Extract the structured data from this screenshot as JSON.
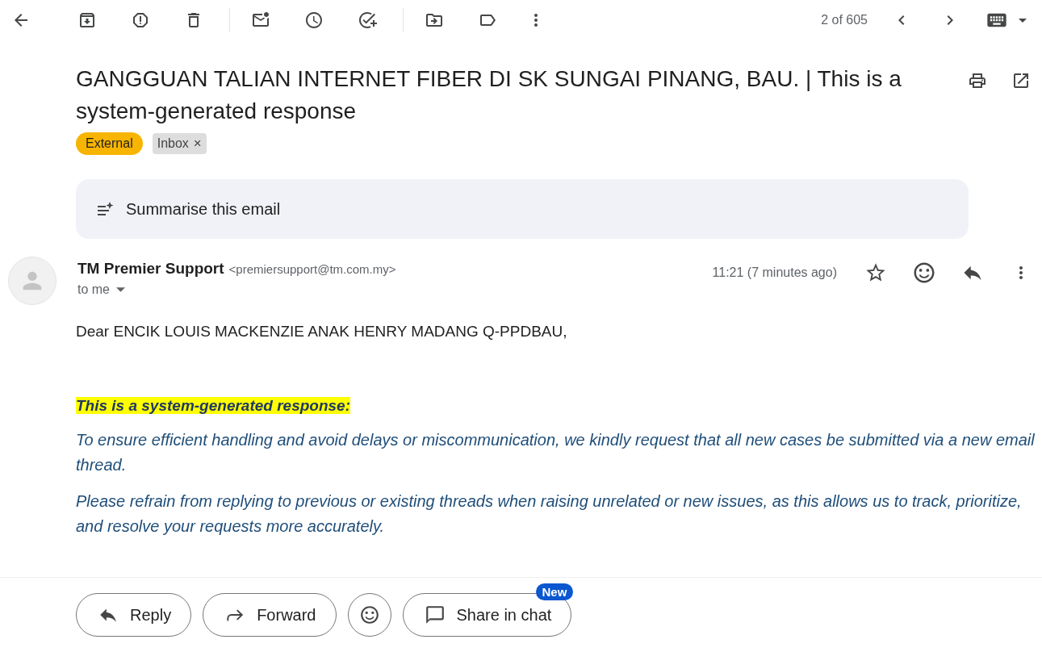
{
  "toolbar": {
    "counter": "2 of 605"
  },
  "subject": "GANGGUAN TALIAN INTERNET FIBER DI SK SUNGAI PINANG, BAU. | This is a system-generated response",
  "labels": [
    {
      "kind": "external",
      "text": "External"
    },
    {
      "kind": "inbox",
      "text": "Inbox",
      "remove": "×"
    }
  ],
  "summarise": "Summarise this email",
  "message": {
    "sender": "TM Premier Support",
    "email": "<premiersupport@tm.com.my>",
    "to": "to me",
    "time": "11:21 (7 minutes ago)",
    "greeting": "Dear ENCIK LOUIS MACKENZIE ANAK HENRY MADANG Q-PPDBAU,",
    "notice": "This is a system-generated response:",
    "paragraphs": [
      "To ensure efficient handling and avoid delays or miscommunication, we kindly request that all new cases be submitted via a new email thread.",
      "Please refrain from replying to previous or existing threads when raising unrelated or new issues, as this allows us to track, prioritize, and resolve your requests more accurately."
    ]
  },
  "actions": [
    {
      "kind": "reply",
      "label": "Reply"
    },
    {
      "kind": "forward",
      "label": "Forward"
    },
    {
      "kind": "emoji"
    },
    {
      "kind": "chat",
      "label": "Share in chat",
      "badge": "New"
    }
  ]
}
